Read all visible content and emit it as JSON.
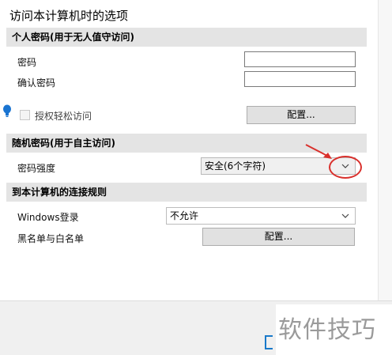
{
  "dialog": {
    "title": "访问本计算机时的选项"
  },
  "personal_password": {
    "header": "个人密码(用于无人值守访问)",
    "password_label": "密码",
    "confirm_label": "确认密码",
    "password_value": "",
    "confirm_value": "",
    "easy_access_label": "授权轻松访问",
    "easy_access_checked": false,
    "config_button": "配置..."
  },
  "random_password": {
    "header": "随机密码(用于自主访问)",
    "strength_label": "密码强度",
    "strength_value": "安全(6个字符)"
  },
  "connection_rules": {
    "header": "到本计算机的连接规则",
    "windows_login_label": "Windows登录",
    "windows_login_value": "不允许",
    "blacklist_label": "黑名单与白名单",
    "config_button": "配置..."
  },
  "watermark": "软件技巧",
  "colors": {
    "annotation": "#d9302c",
    "bulb": "#1a74d1",
    "header_bg": "#e4e4e4"
  }
}
